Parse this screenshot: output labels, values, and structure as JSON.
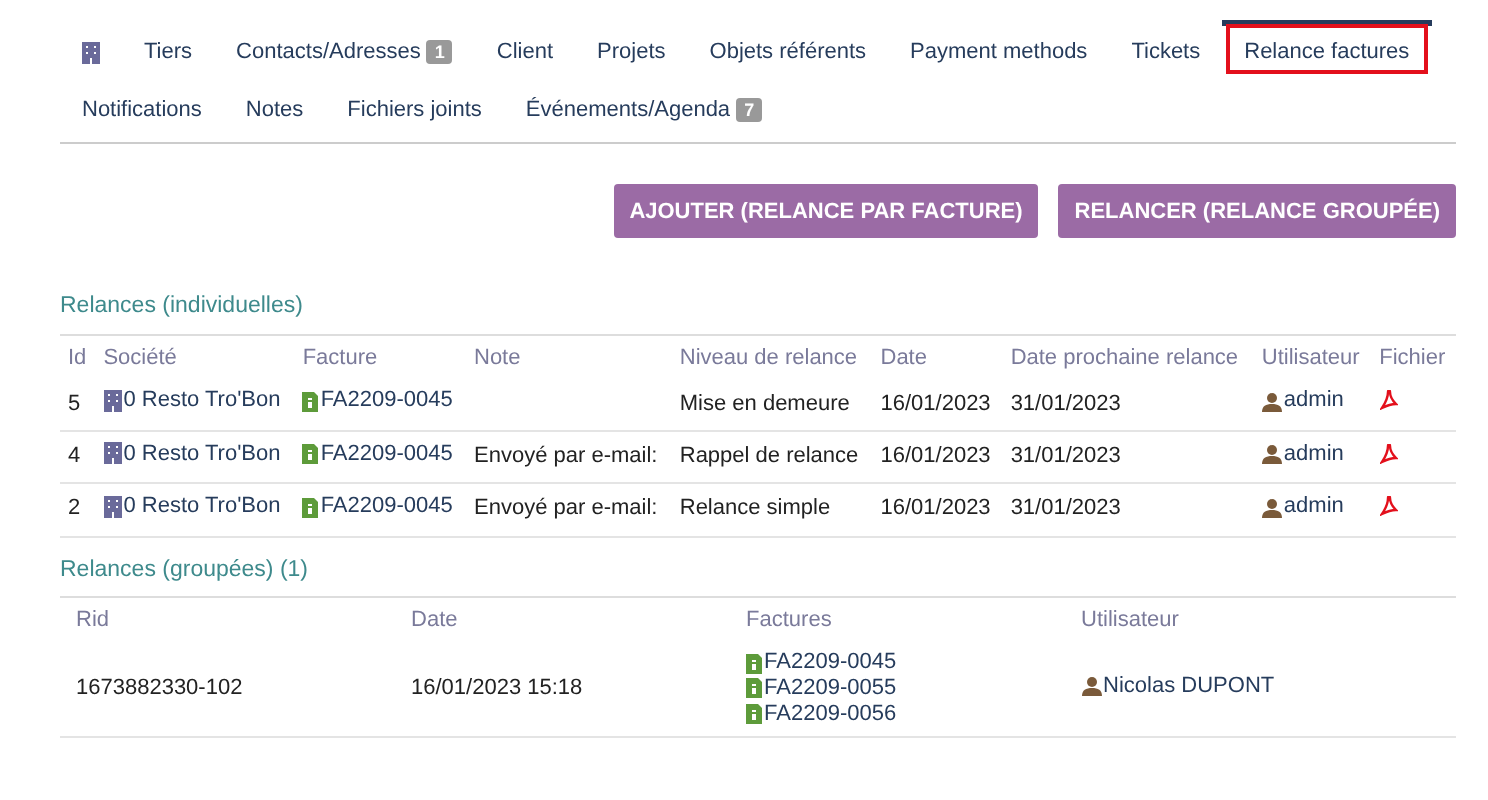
{
  "tabs": [
    {
      "kind": "icon",
      "selected": false,
      "highlighted": false
    },
    {
      "kind": "text",
      "label": "Tiers",
      "selected": false,
      "highlighted": false
    },
    {
      "kind": "text",
      "label": "Contacts/Adresses",
      "badge": "1",
      "selected": false,
      "highlighted": false
    },
    {
      "kind": "text",
      "label": "Client",
      "selected": false,
      "highlighted": false
    },
    {
      "kind": "text",
      "label": "Projets",
      "selected": false,
      "highlighted": false
    },
    {
      "kind": "text",
      "label": "Objets référents",
      "selected": false,
      "highlighted": false
    },
    {
      "kind": "text",
      "label": "Payment methods",
      "selected": false,
      "highlighted": false
    },
    {
      "kind": "text",
      "label": "Tickets",
      "selected": false,
      "highlighted": false
    },
    {
      "kind": "text",
      "label": "Relance factures",
      "selected": true,
      "highlighted": true
    },
    {
      "kind": "text",
      "label": "Notifications",
      "selected": false,
      "highlighted": false
    },
    {
      "kind": "text",
      "label": "Notes",
      "selected": false,
      "highlighted": false
    },
    {
      "kind": "text",
      "label": "Fichiers joints",
      "selected": false,
      "highlighted": false
    },
    {
      "kind": "text",
      "label": "Événements/Agenda",
      "badge": "7",
      "selected": false,
      "highlighted": false
    }
  ],
  "buttons": [
    "AJOUTER (RELANCE PAR FACTURE)",
    "RELANCER (RELANCE GROUPÉE)"
  ],
  "individual": {
    "title": "Relances (individuelles)",
    "columns": [
      "Id",
      "Société",
      "Facture",
      "Note",
      "Niveau de relance",
      "Date",
      "Date prochaine relance",
      "Utilisateur",
      "Fichier"
    ],
    "rows": [
      {
        "id": "5",
        "company": "0 Resto Tro'Bon",
        "invoice": "FA2209-0045",
        "note": "",
        "level": "Mise en demeure",
        "date": "16/01/2023",
        "next": "31/01/2023",
        "user": "admin"
      },
      {
        "id": "4",
        "company": "0 Resto Tro'Bon",
        "invoice": "FA2209-0045",
        "note": "Envoyé par e-mail:",
        "level": "Rappel de relance",
        "date": "16/01/2023",
        "next": "31/01/2023",
        "user": "admin"
      },
      {
        "id": "2",
        "company": "0 Resto Tro'Bon",
        "invoice": "FA2209-0045",
        "note": "Envoyé par e-mail:",
        "level": "Relance simple",
        "date": "16/01/2023",
        "next": "31/01/2023",
        "user": "admin"
      }
    ]
  },
  "grouped": {
    "title": "Relances (groupées) (1)",
    "columns": [
      "Rid",
      "Date",
      "Factures",
      "Utilisateur"
    ],
    "rows": [
      {
        "rid": "1673882330-102",
        "date": "16/01/2023 15:18",
        "invoices": [
          "FA2209-0045",
          "FA2209-0055",
          "FA2209-0056"
        ],
        "user": "Nicolas DUPONT"
      }
    ]
  }
}
